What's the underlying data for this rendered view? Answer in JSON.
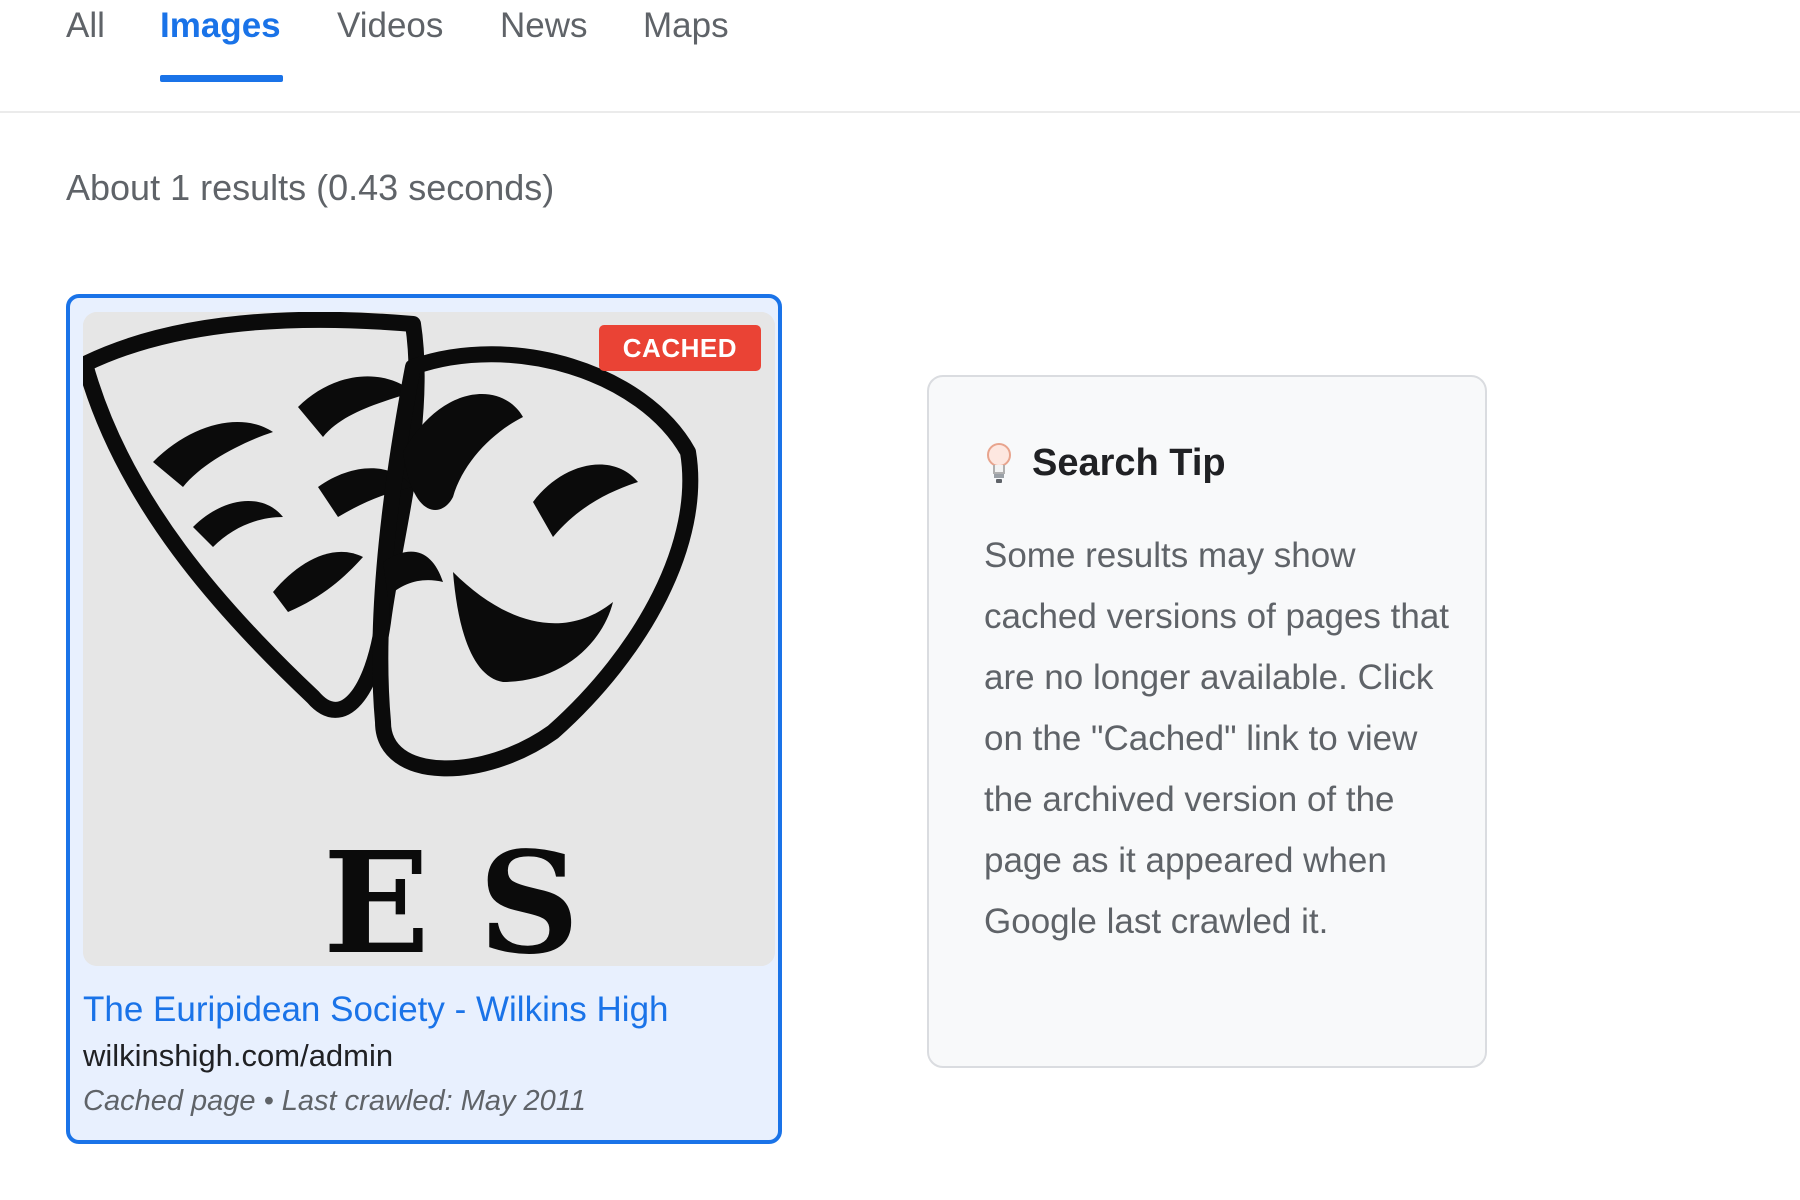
{
  "nav": {
    "tabs": [
      {
        "label": "All"
      },
      {
        "label": "Images",
        "active": true
      },
      {
        "label": "Videos"
      },
      {
        "label": "News"
      },
      {
        "label": "Maps"
      }
    ]
  },
  "results": {
    "stats": "About 1 results (0.43 seconds)",
    "items": [
      {
        "badge": "CACHED",
        "title": "The Euripidean Society - Wilkins High",
        "url": "wilkinshigh.com/admin",
        "meta": "Cached page • Last crawled: May 2011",
        "image_letters": "E S"
      }
    ]
  },
  "tip": {
    "icon": "lightbulb-icon",
    "title": "Search Tip",
    "body": "Some results may show cached versions of pages that are no longer available. Click on the \"Cached\" link to view the archived version of the page as it appeared when Google last crawled it."
  },
  "colors": {
    "accent": "#1a73e8",
    "badge": "#ea4335",
    "card_bg": "#e8f0fe"
  }
}
